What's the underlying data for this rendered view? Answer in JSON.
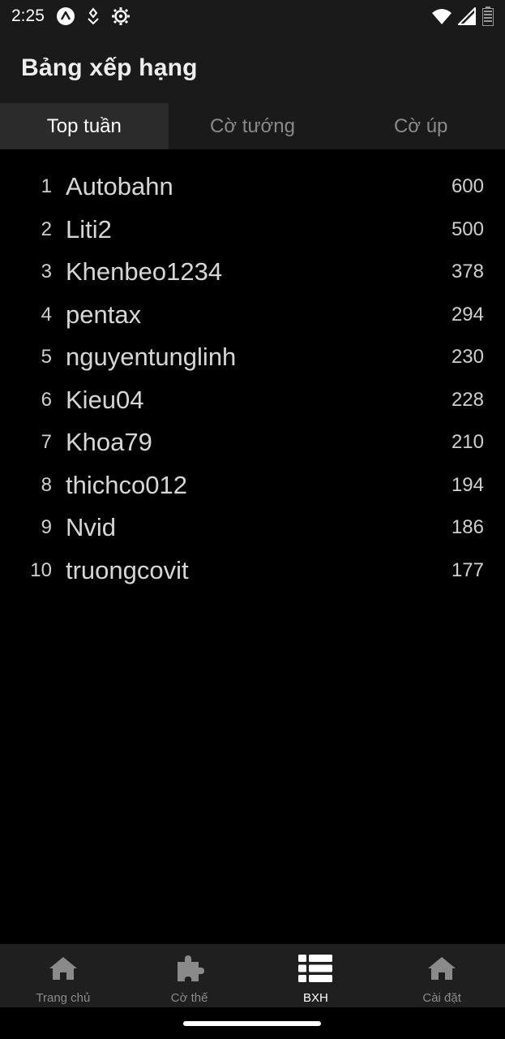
{
  "status_bar": {
    "time": "2:25",
    "icons_left": [
      "autofill-icon",
      "download-icon",
      "settings-gear-icon"
    ],
    "icons_right": [
      "wifi-icon",
      "signal-icon",
      "battery-icon"
    ]
  },
  "app_bar": {
    "title": "Bảng xếp hạng"
  },
  "tabs": [
    {
      "label": "Top tuần",
      "active": true
    },
    {
      "label": "Cờ tướng",
      "active": false
    },
    {
      "label": "Cờ úp",
      "active": false
    }
  ],
  "leaderboard": [
    {
      "rank": "1",
      "name": "Autobahn",
      "score": "600"
    },
    {
      "rank": "2",
      "name": "Liti2",
      "score": "500"
    },
    {
      "rank": "3",
      "name": "Khenbeo1234",
      "score": "378"
    },
    {
      "rank": "4",
      "name": "pentax",
      "score": "294"
    },
    {
      "rank": "5",
      "name": "nguyentunglinh",
      "score": "230"
    },
    {
      "rank": "6",
      "name": "Kieu04",
      "score": "228"
    },
    {
      "rank": "7",
      "name": "Khoa79",
      "score": "210"
    },
    {
      "rank": "8",
      "name": "thichco012",
      "score": "194"
    },
    {
      "rank": "9",
      "name": "Nvid",
      "score": "186"
    },
    {
      "rank": "10",
      "name": "truongcovit",
      "score": "177"
    }
  ],
  "bottom_nav": [
    {
      "label": "Trang chủ",
      "icon": "home-icon",
      "active": false
    },
    {
      "label": "Cờ thế",
      "icon": "puzzle-icon",
      "active": false
    },
    {
      "label": "BXH",
      "icon": "list-icon",
      "active": true
    },
    {
      "label": "Cài đặt",
      "icon": "home-icon",
      "active": false
    }
  ],
  "colors": {
    "background": "#000000",
    "bar": "#1a1a1a",
    "active_tab": "#2b2b2b",
    "inactive_text": "#8a8a8a",
    "active_text": "#ffffff"
  }
}
